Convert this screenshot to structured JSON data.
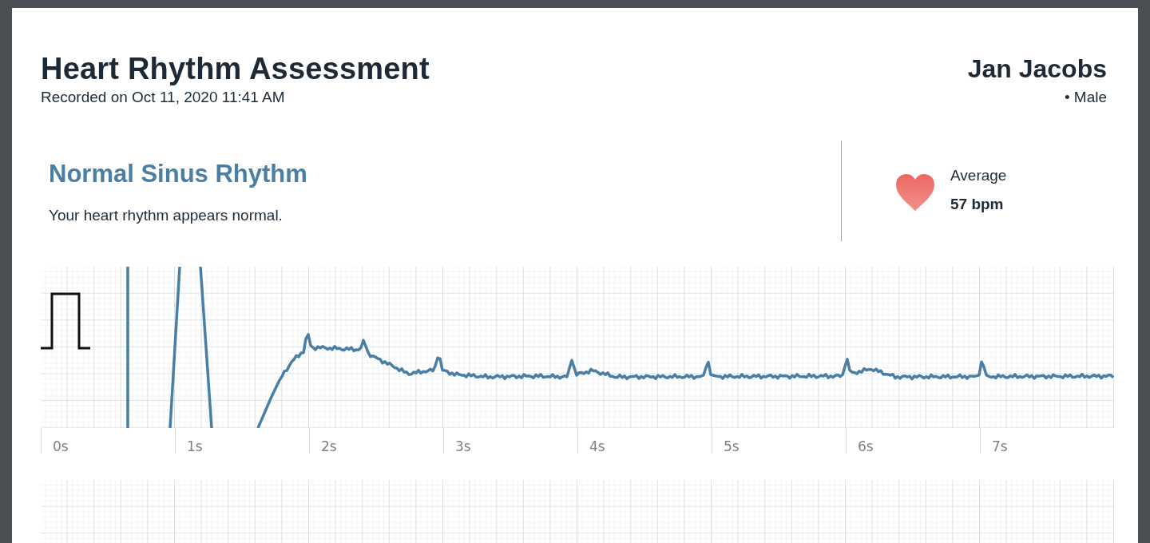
{
  "report": {
    "title": "Heart Rhythm Assessment",
    "recorded": "Recorded on Oct 11, 2020 11:41 AM"
  },
  "patient": {
    "name": "Jan Jacobs",
    "sex": "• Male"
  },
  "result": {
    "classification": "Normal Sinus Rhythm",
    "description": "Your heart rhythm appears normal.",
    "average_label": "Average",
    "average_value": "57 bpm"
  },
  "rhythm_strip": {
    "time_labels": [
      "0s",
      "1s",
      "2s",
      "3s",
      "4s",
      "5s",
      "6s",
      "7s"
    ]
  }
}
